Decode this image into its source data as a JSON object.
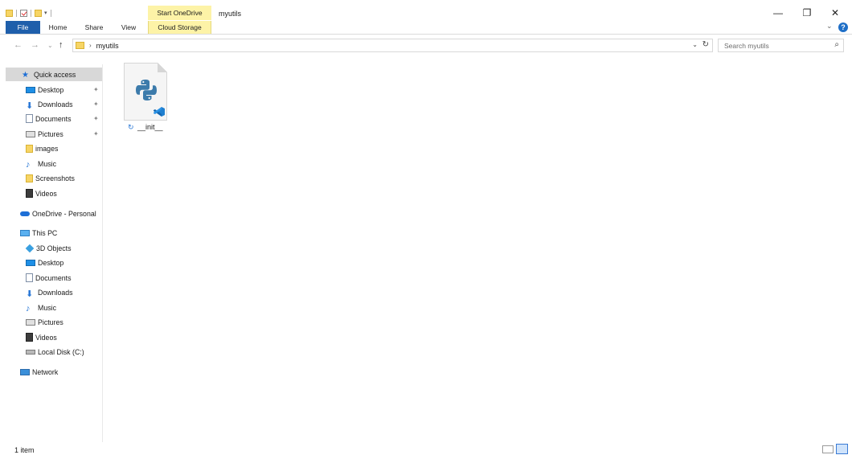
{
  "titlebar": {
    "start_onedrive": "Start OneDrive",
    "window_title": "myutils",
    "minimize": "—",
    "maximize": "❐",
    "close": "✕"
  },
  "ribbon": {
    "tabs": [
      {
        "label": "File"
      },
      {
        "label": "Home"
      },
      {
        "label": "Share"
      },
      {
        "label": "View"
      },
      {
        "label": "Cloud Storage"
      }
    ],
    "expand_chevron": "⌄",
    "help": "?"
  },
  "navigation": {
    "back": "←",
    "forward": "→",
    "recent": "⌄",
    "up": "↑",
    "breadcrumb_sep": "›",
    "address": "myutils",
    "address_dropdown": "⌄",
    "refresh": "↻",
    "search_placeholder": "Search myutils",
    "search_icon": "⌕"
  },
  "sidebar": {
    "quick_access": {
      "label": "Quick access",
      "icon": "star-icon"
    },
    "quick_items": [
      {
        "label": "Desktop",
        "icon": "desktop-icon",
        "pinned": true
      },
      {
        "label": "Downloads",
        "icon": "download-icon",
        "pinned": true
      },
      {
        "label": "Documents",
        "icon": "documents-icon",
        "pinned": true
      },
      {
        "label": "Pictures",
        "icon": "pictures-icon",
        "pinned": true
      },
      {
        "label": "images",
        "icon": "folder-icon",
        "pinned": false
      },
      {
        "label": "Music",
        "icon": "music-icon",
        "pinned": false
      },
      {
        "label": "Screenshots",
        "icon": "folder-icon",
        "pinned": false
      },
      {
        "label": "Videos",
        "icon": "videos-icon",
        "pinned": false
      }
    ],
    "onedrive": {
      "label": "OneDrive - Personal",
      "icon": "cloud-icon"
    },
    "this_pc": {
      "label": "This PC",
      "icon": "pc-icon"
    },
    "pc_items": [
      {
        "label": "3D Objects",
        "icon": "3d-objects-icon"
      },
      {
        "label": "Desktop",
        "icon": "desktop-icon"
      },
      {
        "label": "Documents",
        "icon": "documents-icon"
      },
      {
        "label": "Downloads",
        "icon": "download-icon"
      },
      {
        "label": "Music",
        "icon": "music-icon"
      },
      {
        "label": "Pictures",
        "icon": "pictures-icon"
      },
      {
        "label": "Videos",
        "icon": "videos-icon"
      },
      {
        "label": "Local Disk (C:)",
        "icon": "disk-icon"
      }
    ],
    "network": {
      "label": "Network",
      "icon": "network-icon"
    },
    "pin_glyph": "✦"
  },
  "content": {
    "files": [
      {
        "name": "__init__",
        "icon": "python-file-icon",
        "sync_icon": "sync-icon"
      }
    ]
  },
  "status": {
    "count": "1 item"
  },
  "colors": {
    "file_tab": "#1f5fab",
    "onedrive_tab": "#fdf3a7",
    "selected_nav": "#d8d8d8",
    "accent": "#1e6fd6"
  }
}
